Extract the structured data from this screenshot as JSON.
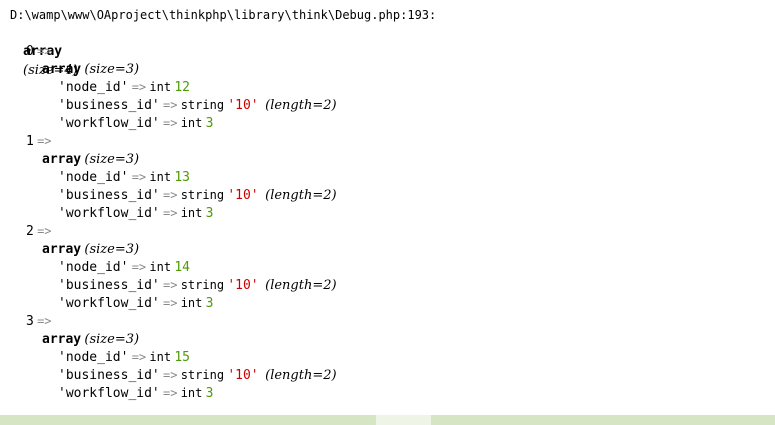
{
  "debug": {
    "file_path": "D:\\wamp\\www\\OAproject\\thinkphp\\library\\think\\Debug.php:193:",
    "root": {
      "type": "array",
      "size": "(size=4)"
    },
    "arrow": "=>",
    "nested_type": "array",
    "nested_size": "(size=3)",
    "entries": [
      {
        "index": "0",
        "fields": [
          {
            "key": "'node_id'",
            "type": "int",
            "value": "12",
            "extra": ""
          },
          {
            "key": "'business_id'",
            "type": "string",
            "value": "'10'",
            "extra": "(length=2)"
          },
          {
            "key": "'workflow_id'",
            "type": "int",
            "value": "3",
            "extra": ""
          }
        ]
      },
      {
        "index": "1",
        "fields": [
          {
            "key": "'node_id'",
            "type": "int",
            "value": "13",
            "extra": ""
          },
          {
            "key": "'business_id'",
            "type": "string",
            "value": "'10'",
            "extra": "(length=2)"
          },
          {
            "key": "'workflow_id'",
            "type": "int",
            "value": "3",
            "extra": ""
          }
        ]
      },
      {
        "index": "2",
        "fields": [
          {
            "key": "'node_id'",
            "type": "int",
            "value": "14",
            "extra": ""
          },
          {
            "key": "'business_id'",
            "type": "string",
            "value": "'10'",
            "extra": "(length=2)"
          },
          {
            "key": "'workflow_id'",
            "type": "int",
            "value": "3",
            "extra": ""
          }
        ]
      },
      {
        "index": "3",
        "fields": [
          {
            "key": "'node_id'",
            "type": "int",
            "value": "15",
            "extra": ""
          },
          {
            "key": "'business_id'",
            "type": "string",
            "value": "'10'",
            "extra": "(length=2)"
          },
          {
            "key": "'workflow_id'",
            "type": "int",
            "value": "3",
            "extra": ""
          }
        ]
      }
    ]
  },
  "colors": {
    "int_value": "#4e9a06",
    "string_value": "#cc0000",
    "arrow": "#888a85",
    "strip": "#d6e6c4"
  }
}
